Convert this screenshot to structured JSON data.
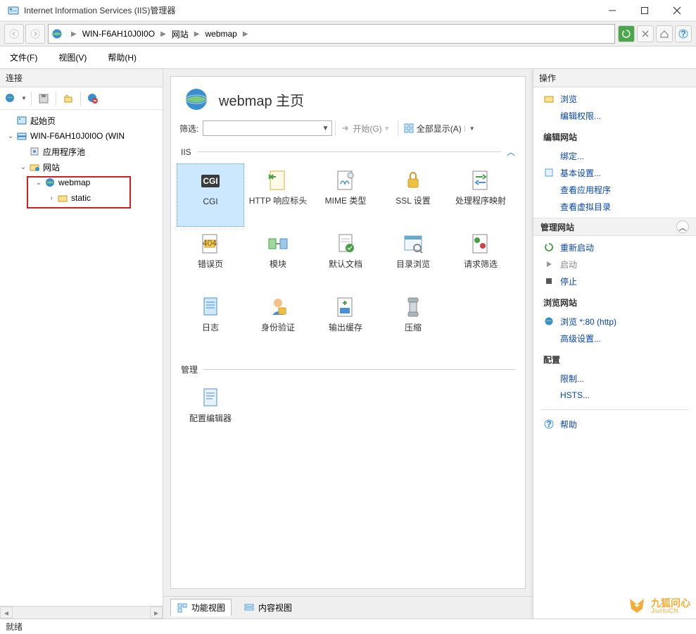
{
  "window": {
    "title": "Internet Information Services (IIS)管理器",
    "minimize": "—",
    "maximize": "□",
    "close": "✕"
  },
  "breadcrumbs": [
    "WIN-F6AH10J0I0O",
    "网站",
    "webmap"
  ],
  "menubar": {
    "file": "文件(F)",
    "view": "视图(V)",
    "help": "帮助(H)"
  },
  "left": {
    "header": "连接",
    "tree": {
      "start": "起始页",
      "server": "WIN-F6AH10J0I0O (WIN",
      "apppools": "应用程序池",
      "sites": "网站",
      "webmap": "webmap",
      "static": "static"
    }
  },
  "center": {
    "title": "webmap 主页",
    "filter_label": "筛选:",
    "filter_value": "",
    "start_btn": "开始(G)",
    "showall_btn": "全部显示(A)",
    "section_iis": "IIS",
    "section_mgmt": "管理",
    "icons": [
      {
        "key": "cgi",
        "label": "CGI"
      },
      {
        "key": "httpresp",
        "label": "HTTP 响应标头"
      },
      {
        "key": "mime",
        "label": "MIME 类型"
      },
      {
        "key": "ssl",
        "label": "SSL 设置"
      },
      {
        "key": "handler",
        "label": "处理程序映射"
      },
      {
        "key": "error",
        "label": "错误页"
      },
      {
        "key": "modules",
        "label": "模块"
      },
      {
        "key": "defaultdoc",
        "label": "默认文档"
      },
      {
        "key": "dirbrowse",
        "label": "目录浏览"
      },
      {
        "key": "reqfilter",
        "label": "请求筛选"
      },
      {
        "key": "logging",
        "label": "日志"
      },
      {
        "key": "auth",
        "label": "身份验证"
      },
      {
        "key": "outputcache",
        "label": "输出缓存"
      },
      {
        "key": "compress",
        "label": "压缩"
      }
    ],
    "mgmticons": [
      {
        "key": "cfgedit",
        "label": "配置编辑器"
      }
    ],
    "tab_features": "功能视图",
    "tab_content": "内容视图"
  },
  "right": {
    "header": "操作",
    "browse": "浏览",
    "edit_perm": "编辑权限...",
    "edit_site_hdr": "编辑网站",
    "bindings": "绑定...",
    "basic_settings": "基本设置...",
    "view_apps": "查看应用程序",
    "view_vdirs": "查看虚拟目录",
    "manage_site_hdr": "管理网站",
    "restart": "重新启动",
    "start": "启动",
    "stop": "停止",
    "browse_site_hdr": "浏览网站",
    "browse_http": "浏览 *:80 (http)",
    "advanced": "高级设置...",
    "config_hdr": "配置",
    "limits": "限制...",
    "hsts": "HSTS...",
    "help": "帮助"
  },
  "statusbar": {
    "text": "就绪"
  },
  "watermark": {
    "main": "九狐问心",
    "sub": "JiuHuCN"
  }
}
